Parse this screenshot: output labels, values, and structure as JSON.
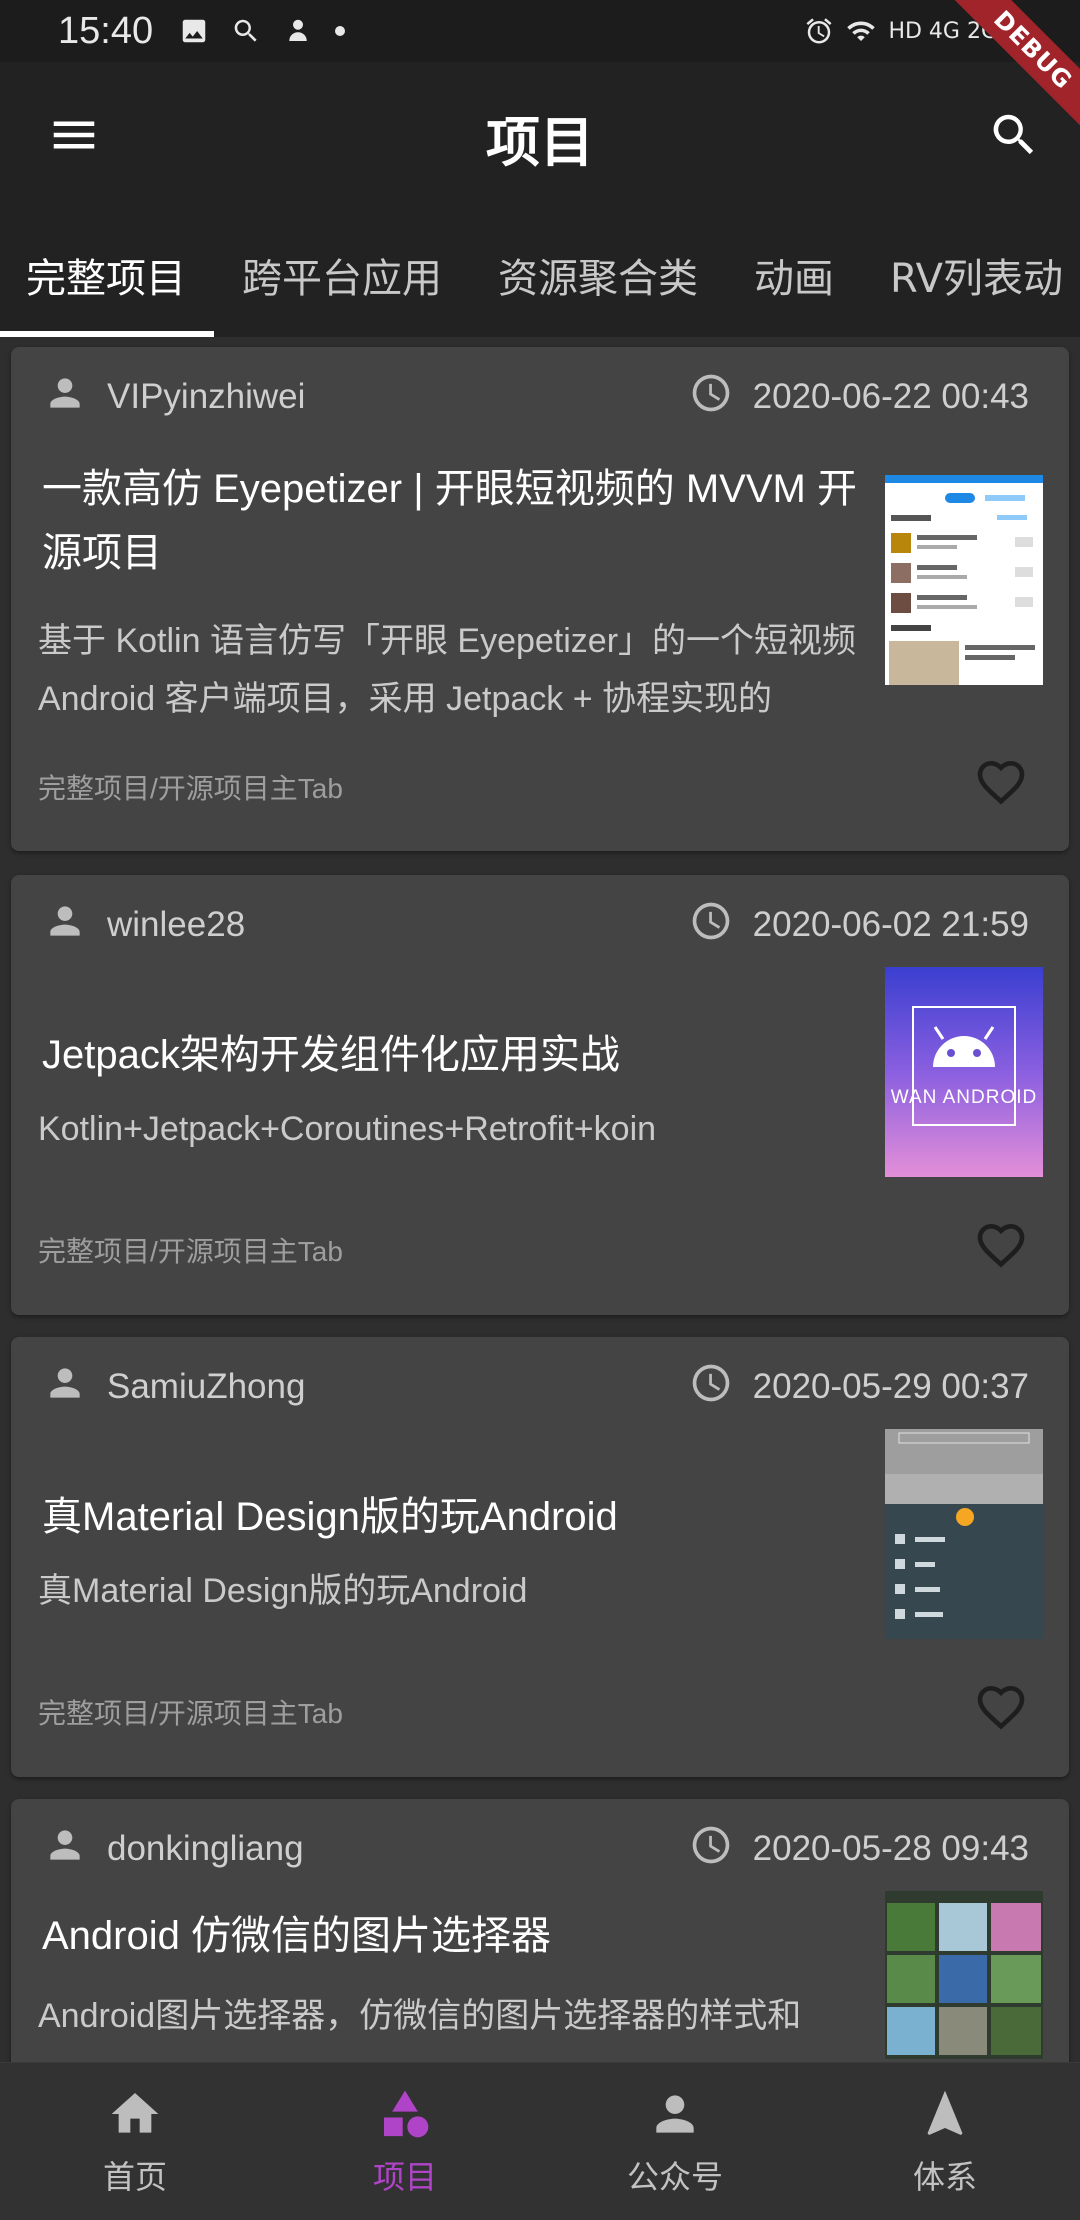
{
  "status_bar": {
    "time": "15:40",
    "network": "HD 4G 2G"
  },
  "app_bar": {
    "title": "项目",
    "menu_icon": "menu-icon",
    "search_icon": "search-icon",
    "debug_banner": "DEBUG"
  },
  "tabs": [
    {
      "label": "完整项目",
      "active": true
    },
    {
      "label": "跨平台应用",
      "active": false
    },
    {
      "label": "资源聚合类",
      "active": false
    },
    {
      "label": "动画",
      "active": false
    },
    {
      "label": "RV列表动",
      "active": false
    }
  ],
  "articles": [
    {
      "author": "VIPyinzhiwei",
      "date": "2020-06-22 00:43",
      "title": "一款高仿 Eyepetizer | 开眼短视频的 MVVM 开源项目",
      "desc": "基于 Kotlin 语言仿写「开眼 Eyepetizer」的一个短视频 Android 客户端项目，采用 Jetpack + 协程实现的",
      "chapter": "完整项目/开源项目主Tab",
      "favorite": false
    },
    {
      "author": "winlee28",
      "date": "2020-06-02 21:59",
      "title": "Jetpack架构开发组件化应用实战",
      "desc": "Kotlin+Jetpack+Coroutines+Retrofit+koin",
      "chapter": "完整项目/开源项目主Tab",
      "favorite": false,
      "thumb_text": "WAN ANDROID"
    },
    {
      "author": "SamiuZhong",
      "date": "2020-05-29 00:37",
      "title": "真Material Design版的玩Android",
      "desc": "真Material Design版的玩Android",
      "chapter": "完整项目/开源项目主Tab",
      "favorite": false
    },
    {
      "author": "donkingliang",
      "date": "2020-05-28 09:43",
      "title": "Android 仿微信的图片选择器",
      "desc": "Android图片选择器，仿微信的图片选择器的样式和",
      "chapter": "",
      "favorite": false
    }
  ],
  "bottom_nav": [
    {
      "label": "首页",
      "icon": "home-icon",
      "active": false
    },
    {
      "label": "项目",
      "icon": "shapes-icon",
      "active": true
    },
    {
      "label": "公众号",
      "icon": "person-icon",
      "active": false
    },
    {
      "label": "体系",
      "icon": "navigation-icon",
      "active": false
    }
  ],
  "colors": {
    "accent": "#b044c8",
    "app_bar": "#222222",
    "card": "#444444",
    "background": "#2e2e2e"
  }
}
